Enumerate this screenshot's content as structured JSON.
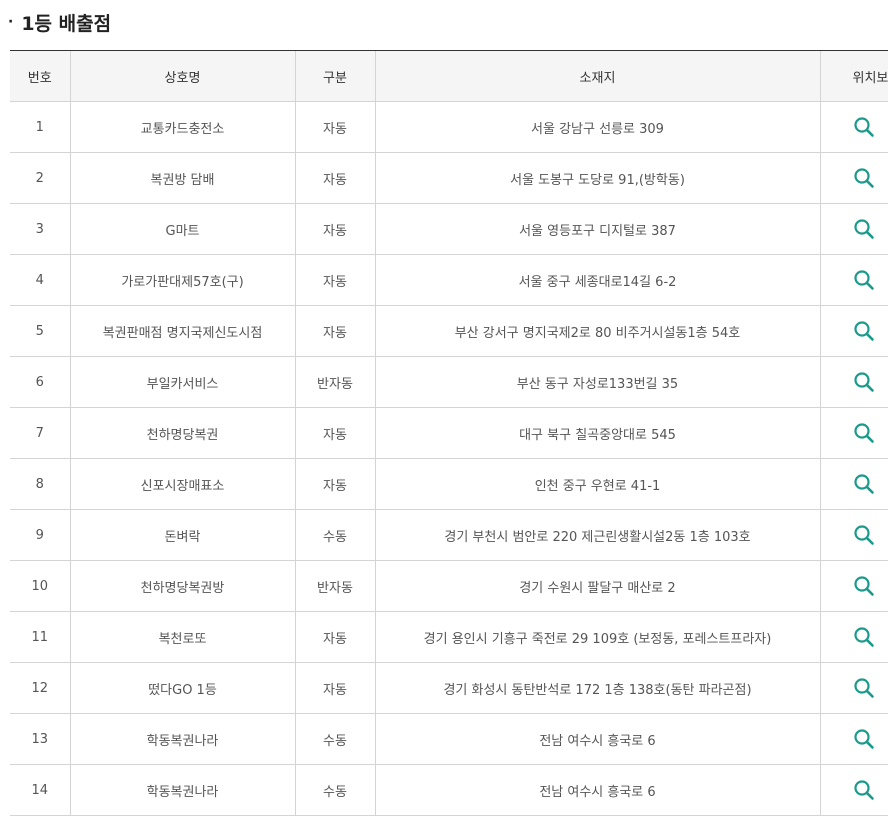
{
  "section": {
    "bullet": "·",
    "title": "1등 배출점"
  },
  "headers": {
    "no": "번호",
    "name": "상호명",
    "type": "구분",
    "address": "소재지",
    "location": "위치보기"
  },
  "icons": {
    "location": "search-icon"
  },
  "colors": {
    "accent": "#1a9a8a",
    "header_bg": "#f5f5f5"
  },
  "rows": [
    {
      "no": "1",
      "name": "교통카드충전소",
      "type": "자동",
      "address": "서울 강남구 선릉로 309"
    },
    {
      "no": "2",
      "name": "복권방 담배",
      "type": "자동",
      "address": "서울 도봉구 도당로 91,(방학동)"
    },
    {
      "no": "3",
      "name": "G마트",
      "type": "자동",
      "address": "서울 영등포구 디지털로 387"
    },
    {
      "no": "4",
      "name": "가로가판대제57호(구)",
      "type": "자동",
      "address": "서울 중구 세종대로14길 6-2"
    },
    {
      "no": "5",
      "name": "복권판매점 명지국제신도시점",
      "type": "자동",
      "address": "부산 강서구 명지국제2로 80 비주거시설동1층 54호"
    },
    {
      "no": "6",
      "name": "부일카서비스",
      "type": "반자동",
      "address": "부산 동구 자성로133번길 35"
    },
    {
      "no": "7",
      "name": "천하명당복권",
      "type": "자동",
      "address": "대구 북구 칠곡중앙대로 545"
    },
    {
      "no": "8",
      "name": "신포시장매표소",
      "type": "자동",
      "address": "인천 중구 우현로 41-1"
    },
    {
      "no": "9",
      "name": "돈벼락",
      "type": "수동",
      "address": "경기 부천시 범안로 220 제근린생활시설2동 1층 103호"
    },
    {
      "no": "10",
      "name": "천하명당복권방",
      "type": "반자동",
      "address": "경기 수원시 팔달구 매산로 2"
    },
    {
      "no": "11",
      "name": "복천로또",
      "type": "자동",
      "address": "경기 용인시 기흥구 죽전로 29 109호 (보정동, 포레스트프라자)"
    },
    {
      "no": "12",
      "name": "떴다GO 1등",
      "type": "자동",
      "address": "경기 화성시 동탄반석로 172 1층 138호(동탄 파라곤점)"
    },
    {
      "no": "13",
      "name": "학동복권나라",
      "type": "수동",
      "address": "전남 여수시 흥국로 6"
    },
    {
      "no": "14",
      "name": "학동복권나라",
      "type": "수동",
      "address": "전남 여수시 흥국로 6"
    }
  ]
}
